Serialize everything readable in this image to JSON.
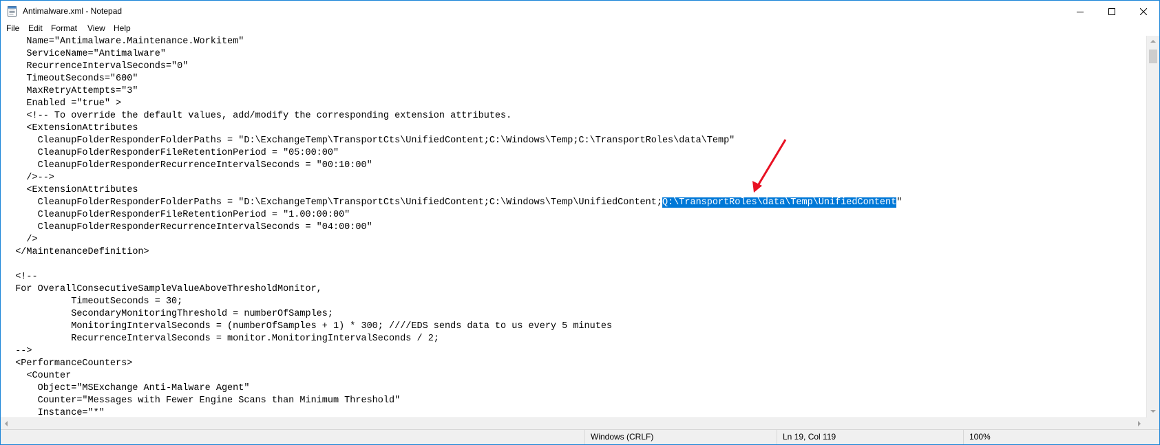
{
  "window": {
    "title": "Antimalware.xml - Notepad",
    "icon": "notepad-icon"
  },
  "window_controls": {
    "minimize_icon": "minimize-icon",
    "maximize_icon": "maximize-icon",
    "close_icon": "close-icon"
  },
  "menu": {
    "items": [
      {
        "label": "File"
      },
      {
        "label": "Edit"
      },
      {
        "label": "Format"
      },
      {
        "label": "View"
      },
      {
        "label": "Help"
      }
    ]
  },
  "editor": {
    "lines_before": [
      "    Name=\"Antimalware.Maintenance.Workitem\"",
      "    ServiceName=\"Antimalware\"",
      "    RecurrenceIntervalSeconds=\"0\"",
      "    TimeoutSeconds=\"600\"",
      "    MaxRetryAttempts=\"3\"",
      "    Enabled =\"true\" >",
      "    <!-- To override the default values, add/modify the corresponding extension attributes.",
      "    <ExtensionAttributes",
      "      CleanupFolderResponderFolderPaths = \"D:\\ExchangeTemp\\TransportCts\\UnifiedContent;C:\\Windows\\Temp;C:\\TransportRoles\\data\\Temp\"",
      "      CleanupFolderResponderFileRetentionPeriod = \"05:00:00\"",
      "      CleanupFolderResponderRecurrenceIntervalSeconds = \"00:10:00\"",
      "    />-->",
      "    <ExtensionAttributes"
    ],
    "highlight_line": {
      "prefix": "      CleanupFolderResponderFolderPaths = \"D:\\ExchangeTemp\\TransportCts\\UnifiedContent;C:\\Windows\\Temp\\UnifiedContent;",
      "selected": "Q:\\TransportRoles\\data\\Temp\\UnifiedContent",
      "suffix": "\""
    },
    "lines_after": [
      "      CleanupFolderResponderFileRetentionPeriod = \"1.00:00:00\"",
      "      CleanupFolderResponderRecurrenceIntervalSeconds = \"04:00:00\"",
      "    />",
      "  </MaintenanceDefinition>",
      "",
      "  <!--",
      "  For OverallConsecutiveSampleValueAboveThresholdMonitor,",
      "            TimeoutSeconds = 30;",
      "            SecondaryMonitoringThreshold = numberOfSamples;",
      "            MonitoringIntervalSeconds = (numberOfSamples + 1) * 300; ////EDS sends data to us every 5 minutes",
      "            RecurrenceIntervalSeconds = monitor.MonitoringIntervalSeconds / 2;",
      "  -->",
      "  <PerformanceCounters>",
      "    <Counter",
      "      Object=\"MSExchange Anti-Malware Agent\"",
      "      Counter=\"Messages with Fewer Engine Scans than Minimum Threshold\"",
      "      Instance=\"*\""
    ]
  },
  "annotation": {
    "arrow_color": "#e81123"
  },
  "colors": {
    "selection": "#0078d7",
    "window_border": "#1883d7"
  },
  "statusbar": {
    "line_ending": "Windows (CRLF)",
    "position": "Ln 19, Col 119",
    "zoom": "100%"
  }
}
